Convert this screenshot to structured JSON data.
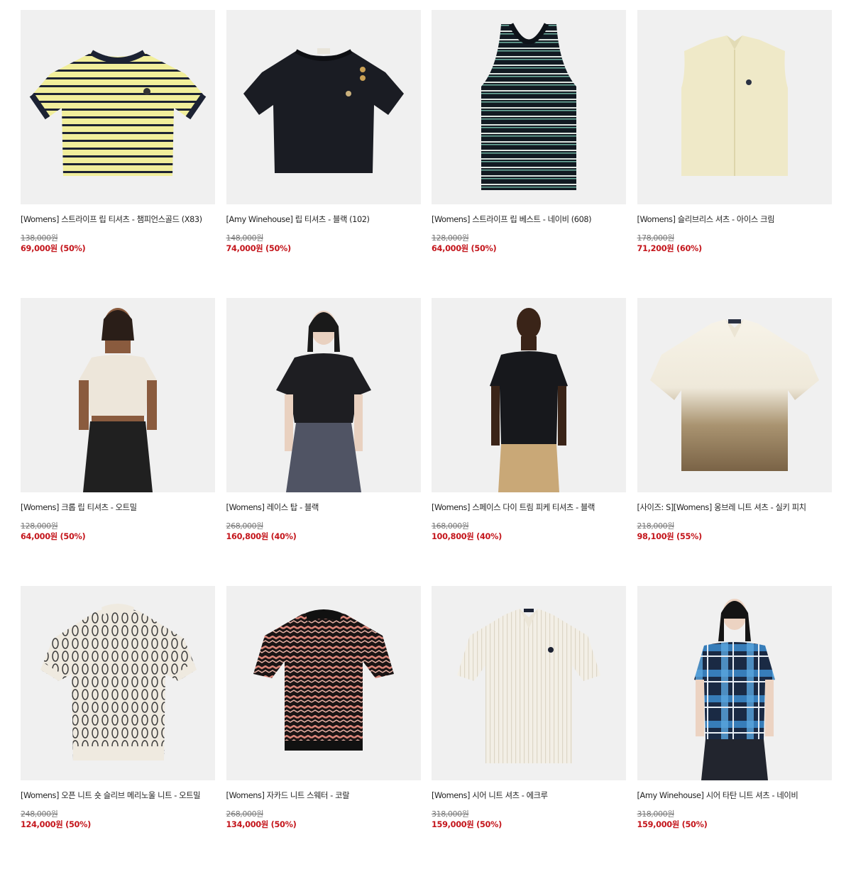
{
  "products": [
    {
      "title": "[Womens] 스트라이프 립 티셔츠 - 챔피언스골드 (X83)",
      "original_price": "138,000원",
      "sale_price": "69,000원 (50%)"
    },
    {
      "title": "[Amy Winehouse] 립 티셔츠 - 블랙 (102)",
      "original_price": "148,000원",
      "sale_price": "74,000원 (50%)"
    },
    {
      "title": "[Womens] 스트라이프 립 베스트 - 네이비 (608)",
      "original_price": "128,000원",
      "sale_price": "64,000원 (50%)"
    },
    {
      "title": "[Womens] 슬리브리스 셔츠 - 아이스 크림",
      "original_price": "178,000원",
      "sale_price": "71,200원 (60%)"
    },
    {
      "title": "[Womens] 크롭 립 티셔츠 - 오트밀",
      "original_price": "128,000원",
      "sale_price": "64,000원 (50%)"
    },
    {
      "title": "[Womens] 레이스 탑 - 블랙",
      "original_price": "268,000원",
      "sale_price": "160,800원 (40%)"
    },
    {
      "title": "[Womens] 스페이스 다이 트림 피케 티셔츠 - 블랙",
      "original_price": "168,000원",
      "sale_price": "100,800원 (40%)"
    },
    {
      "title": "[사이즈: S][Womens] 옹브레 니트 셔츠 - 실키 피치",
      "original_price": "218,000원",
      "sale_price": "98,100원 (55%)"
    },
    {
      "title": "[Womens] 오픈 니트 숏 슬리브 메리노울 니트 - 오트밀",
      "original_price": "248,000원",
      "sale_price": "124,000원 (50%)"
    },
    {
      "title": "[Womens] 자카드 니트 스웨터 - 코랄",
      "original_price": "268,000원",
      "sale_price": "134,000원 (50%)"
    },
    {
      "title": "[Womens] 시어 니트 셔츠 - 에크루",
      "original_price": "318,000원",
      "sale_price": "159,000원 (50%)"
    },
    {
      "title": "[Amy Winehouse] 시어 타탄 니트 셔츠 - 네이비",
      "original_price": "318,000원",
      "sale_price": "159,000원 (50%)"
    }
  ],
  "colors": {
    "thumb_bg": "#f0f0f0",
    "sale_red": "#c4161c",
    "strike_gray": "#777777"
  }
}
